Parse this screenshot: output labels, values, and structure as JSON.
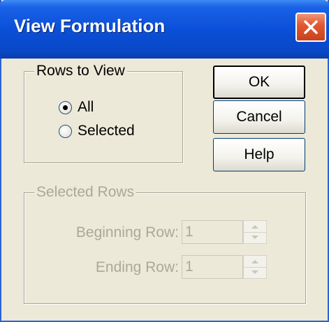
{
  "window": {
    "title": "View Formulation"
  },
  "rows_to_view": {
    "legend": "Rows to View",
    "options": [
      {
        "label": "All",
        "checked": true
      },
      {
        "label": "Selected",
        "checked": false
      }
    ]
  },
  "buttons": {
    "ok": "OK",
    "cancel": "Cancel",
    "help": "Help"
  },
  "selected_rows": {
    "legend": "Selected Rows",
    "enabled": false,
    "beginning_row": {
      "label": "Beginning Row:",
      "value": "1"
    },
    "ending_row": {
      "label": "Ending Row:",
      "value": "1"
    }
  },
  "colors": {
    "title_bar": "#0a4fd9",
    "dialog_bg": "#ece9d8",
    "disabled_text": "#aca899",
    "close_button": "#e25a34"
  }
}
